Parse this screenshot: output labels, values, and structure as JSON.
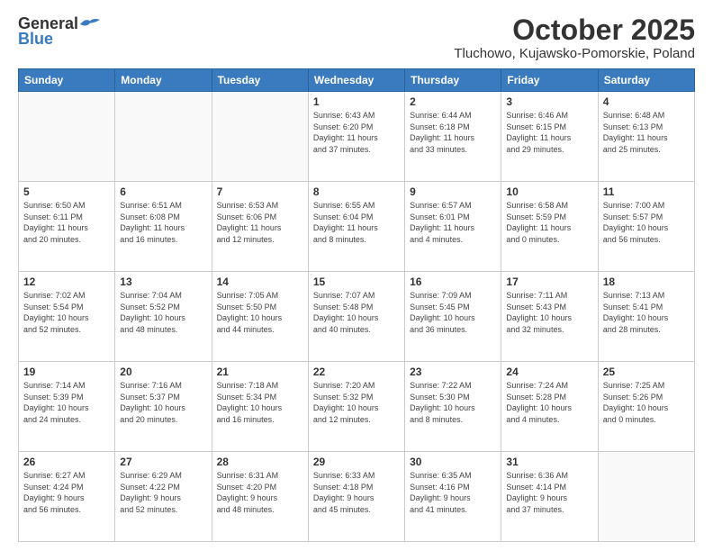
{
  "logo": {
    "general": "General",
    "blue": "Blue"
  },
  "header": {
    "month": "October 2025",
    "location": "Tluchowo, Kujawsko-Pomorskie, Poland"
  },
  "weekdays": [
    "Sunday",
    "Monday",
    "Tuesday",
    "Wednesday",
    "Thursday",
    "Friday",
    "Saturday"
  ],
  "weeks": [
    [
      {
        "day": "",
        "info": ""
      },
      {
        "day": "",
        "info": ""
      },
      {
        "day": "",
        "info": ""
      },
      {
        "day": "1",
        "info": "Sunrise: 6:43 AM\nSunset: 6:20 PM\nDaylight: 11 hours\nand 37 minutes."
      },
      {
        "day": "2",
        "info": "Sunrise: 6:44 AM\nSunset: 6:18 PM\nDaylight: 11 hours\nand 33 minutes."
      },
      {
        "day": "3",
        "info": "Sunrise: 6:46 AM\nSunset: 6:15 PM\nDaylight: 11 hours\nand 29 minutes."
      },
      {
        "day": "4",
        "info": "Sunrise: 6:48 AM\nSunset: 6:13 PM\nDaylight: 11 hours\nand 25 minutes."
      }
    ],
    [
      {
        "day": "5",
        "info": "Sunrise: 6:50 AM\nSunset: 6:11 PM\nDaylight: 11 hours\nand 20 minutes."
      },
      {
        "day": "6",
        "info": "Sunrise: 6:51 AM\nSunset: 6:08 PM\nDaylight: 11 hours\nand 16 minutes."
      },
      {
        "day": "7",
        "info": "Sunrise: 6:53 AM\nSunset: 6:06 PM\nDaylight: 11 hours\nand 12 minutes."
      },
      {
        "day": "8",
        "info": "Sunrise: 6:55 AM\nSunset: 6:04 PM\nDaylight: 11 hours\nand 8 minutes."
      },
      {
        "day": "9",
        "info": "Sunrise: 6:57 AM\nSunset: 6:01 PM\nDaylight: 11 hours\nand 4 minutes."
      },
      {
        "day": "10",
        "info": "Sunrise: 6:58 AM\nSunset: 5:59 PM\nDaylight: 11 hours\nand 0 minutes."
      },
      {
        "day": "11",
        "info": "Sunrise: 7:00 AM\nSunset: 5:57 PM\nDaylight: 10 hours\nand 56 minutes."
      }
    ],
    [
      {
        "day": "12",
        "info": "Sunrise: 7:02 AM\nSunset: 5:54 PM\nDaylight: 10 hours\nand 52 minutes."
      },
      {
        "day": "13",
        "info": "Sunrise: 7:04 AM\nSunset: 5:52 PM\nDaylight: 10 hours\nand 48 minutes."
      },
      {
        "day": "14",
        "info": "Sunrise: 7:05 AM\nSunset: 5:50 PM\nDaylight: 10 hours\nand 44 minutes."
      },
      {
        "day": "15",
        "info": "Sunrise: 7:07 AM\nSunset: 5:48 PM\nDaylight: 10 hours\nand 40 minutes."
      },
      {
        "day": "16",
        "info": "Sunrise: 7:09 AM\nSunset: 5:45 PM\nDaylight: 10 hours\nand 36 minutes."
      },
      {
        "day": "17",
        "info": "Sunrise: 7:11 AM\nSunset: 5:43 PM\nDaylight: 10 hours\nand 32 minutes."
      },
      {
        "day": "18",
        "info": "Sunrise: 7:13 AM\nSunset: 5:41 PM\nDaylight: 10 hours\nand 28 minutes."
      }
    ],
    [
      {
        "day": "19",
        "info": "Sunrise: 7:14 AM\nSunset: 5:39 PM\nDaylight: 10 hours\nand 24 minutes."
      },
      {
        "day": "20",
        "info": "Sunrise: 7:16 AM\nSunset: 5:37 PM\nDaylight: 10 hours\nand 20 minutes."
      },
      {
        "day": "21",
        "info": "Sunrise: 7:18 AM\nSunset: 5:34 PM\nDaylight: 10 hours\nand 16 minutes."
      },
      {
        "day": "22",
        "info": "Sunrise: 7:20 AM\nSunset: 5:32 PM\nDaylight: 10 hours\nand 12 minutes."
      },
      {
        "day": "23",
        "info": "Sunrise: 7:22 AM\nSunset: 5:30 PM\nDaylight: 10 hours\nand 8 minutes."
      },
      {
        "day": "24",
        "info": "Sunrise: 7:24 AM\nSunset: 5:28 PM\nDaylight: 10 hours\nand 4 minutes."
      },
      {
        "day": "25",
        "info": "Sunrise: 7:25 AM\nSunset: 5:26 PM\nDaylight: 10 hours\nand 0 minutes."
      }
    ],
    [
      {
        "day": "26",
        "info": "Sunrise: 6:27 AM\nSunset: 4:24 PM\nDaylight: 9 hours\nand 56 minutes."
      },
      {
        "day": "27",
        "info": "Sunrise: 6:29 AM\nSunset: 4:22 PM\nDaylight: 9 hours\nand 52 minutes."
      },
      {
        "day": "28",
        "info": "Sunrise: 6:31 AM\nSunset: 4:20 PM\nDaylight: 9 hours\nand 48 minutes."
      },
      {
        "day": "29",
        "info": "Sunrise: 6:33 AM\nSunset: 4:18 PM\nDaylight: 9 hours\nand 45 minutes."
      },
      {
        "day": "30",
        "info": "Sunrise: 6:35 AM\nSunset: 4:16 PM\nDaylight: 9 hours\nand 41 minutes."
      },
      {
        "day": "31",
        "info": "Sunrise: 6:36 AM\nSunset: 4:14 PM\nDaylight: 9 hours\nand 37 minutes."
      },
      {
        "day": "",
        "info": ""
      }
    ]
  ]
}
